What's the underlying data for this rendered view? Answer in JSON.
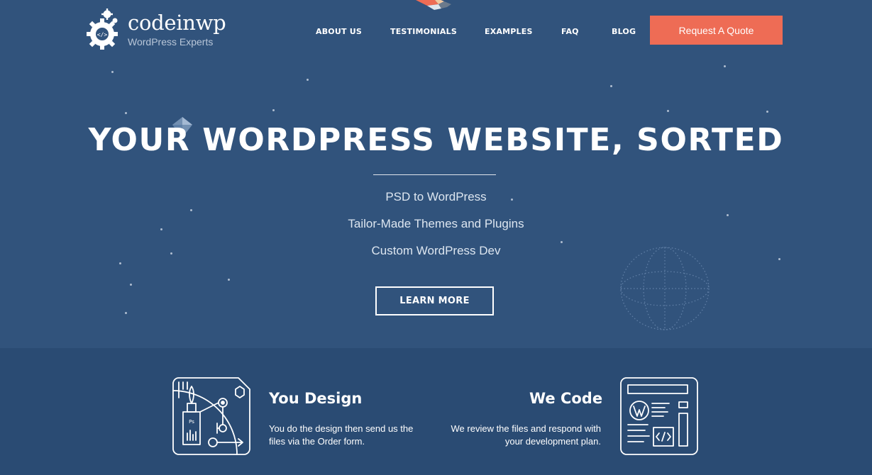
{
  "header": {
    "logo": {
      "name": "codeinwp",
      "tagline": "WordPress Experts"
    },
    "nav": [
      "ABOUT US",
      "TESTIMONIALS",
      "EXAMPLES",
      "FAQ",
      "BLOG"
    ],
    "cta_label": "Request A Quote"
  },
  "hero": {
    "title": "YOUR WORDPRESS WEBSITE, SORTED",
    "features": [
      "PSD to WordPress",
      "Tailor-Made Themes and Plugins",
      "Custom WordPress Dev"
    ],
    "button_label": "LEARN MORE"
  },
  "steps": {
    "design": {
      "title": "You Design",
      "desc": "You do the design then send us the files via the Order form.",
      "icon": "design-tools-icon"
    },
    "code": {
      "title": "We Code",
      "desc": "We review the files and respond with your development plan.",
      "icon": "wordpress-code-icon"
    }
  },
  "colors": {
    "hero_bg": "#31537c",
    "lower_bg": "#2a4b73",
    "accent": "#ee6c55"
  }
}
